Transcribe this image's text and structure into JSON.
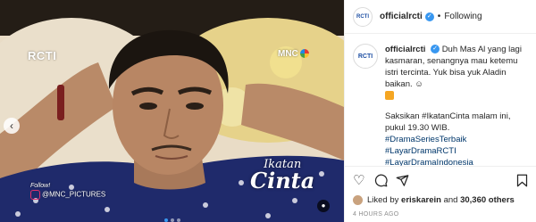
{
  "post": {
    "channel_logo": "RCTI",
    "network_logo": "MNC",
    "title_overlay_small": "Ikatan",
    "title_overlay_big": "Cinta",
    "watermark_follow": "Follow!",
    "watermark_handle": "@MNC_PICTURES",
    "prev_icon": "‹",
    "carousel_count": 3,
    "carousel_active": 1
  },
  "header": {
    "avatar_text": "RCTI",
    "username": "officialrcti",
    "separator": "•",
    "follow_label": "Following"
  },
  "caption": {
    "avatar_text": "RCTI",
    "username": "officialrcti",
    "text1": "Duh Mas Al yang lagi kasmaran, senangnya mau ketemu istri tercinta. Yuk bisa yuk Aladin baikan. ☺",
    "text2": "Saksikan #IkatanCinta malam ini, pukul 19.30 WIB.",
    "hashtags": [
      "#DramaSeriesTerbaik",
      "#LayarDramaRCTI",
      "#LayarDramaIndonesia"
    ]
  },
  "actions": {
    "like_icon": "heart-icon",
    "comment_icon": "comment-icon",
    "share_icon": "share-icon",
    "save_icon": "bookmark-icon"
  },
  "likes": {
    "prefix": "Liked by ",
    "liker": "eriskarein",
    "middle": " and ",
    "count": "30,360 others"
  },
  "timestamp": "4 HOURS AGO",
  "colors": {
    "verified": "#3897f0",
    "hashtag": "#00376b",
    "brand_blue": "#1e4fa3"
  }
}
